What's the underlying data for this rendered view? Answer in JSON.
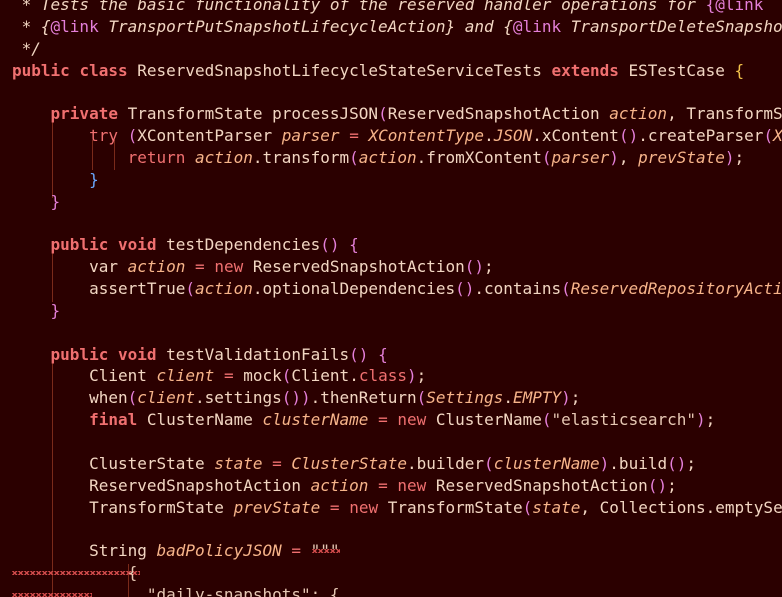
{
  "editor": {
    "lines": [
      [
        [
          "cmt",
          " * Tests the basic functionality of the reserved handler operations for "
        ],
        [
          "cmt-link",
          "{@link "
        ]
      ],
      [
        [
          "cmt",
          " * {"
        ],
        [
          "cmt-link",
          "@link"
        ],
        [
          "cmt",
          " TransportPutSnapshotLifecycleAction} and {"
        ],
        [
          "cmt-link",
          "@link"
        ],
        [
          "cmt",
          " TransportDeleteSnapshot"
        ]
      ],
      [
        [
          "cmt",
          " */"
        ]
      ],
      [
        [
          "kw",
          "public"
        ],
        [
          "punc",
          " "
        ],
        [
          "kw",
          "class"
        ],
        [
          "punc",
          " ReservedSnapshotLifecycleStateServiceTests "
        ],
        [
          "kw",
          "extends"
        ],
        [
          "punc",
          " ESTestCase "
        ],
        [
          "brace-y",
          "{"
        ]
      ],
      [],
      [
        [
          "punc",
          "    "
        ],
        [
          "kw",
          "private"
        ],
        [
          "punc",
          " TransformState processJSON"
        ],
        [
          "paren",
          "("
        ],
        [
          "punc",
          "ReservedSnapshotAction "
        ],
        [
          "var",
          "action"
        ],
        [
          "punc",
          ", TransformS"
        ]
      ],
      [
        [
          "punc",
          "        "
        ],
        [
          "kw2",
          "try"
        ],
        [
          "punc",
          " "
        ],
        [
          "paren",
          "("
        ],
        [
          "punc",
          "XContentParser "
        ],
        [
          "var",
          "parser"
        ],
        [
          "punc",
          " "
        ],
        [
          "op",
          "="
        ],
        [
          "punc",
          " "
        ],
        [
          "const",
          "XContentType"
        ],
        [
          "punc",
          "."
        ],
        [
          "const",
          "JSON"
        ],
        [
          "punc",
          ".xContent"
        ],
        [
          "paren",
          "()"
        ],
        [
          "punc",
          ".createParser"
        ],
        [
          "paren",
          "("
        ],
        [
          "var",
          "X"
        ]
      ],
      [
        [
          "punc",
          "            "
        ],
        [
          "kw2",
          "return"
        ],
        [
          "punc",
          " "
        ],
        [
          "var",
          "action"
        ],
        [
          "punc",
          ".transform"
        ],
        [
          "paren",
          "("
        ],
        [
          "var",
          "action"
        ],
        [
          "punc",
          ".fromXContent"
        ],
        [
          "paren",
          "("
        ],
        [
          "var",
          "parser"
        ],
        [
          "paren",
          ")"
        ],
        [
          "punc",
          ", "
        ],
        [
          "var",
          "prevState"
        ],
        [
          "paren",
          ")"
        ],
        [
          "punc",
          ";"
        ]
      ],
      [
        [
          "punc",
          "        "
        ],
        [
          "brace-b",
          "}"
        ]
      ],
      [
        [
          "punc",
          "    "
        ],
        [
          "brace-o",
          "}"
        ]
      ],
      [],
      [
        [
          "punc",
          "    "
        ],
        [
          "kw",
          "public"
        ],
        [
          "punc",
          " "
        ],
        [
          "kw",
          "void"
        ],
        [
          "punc",
          " testDependencies"
        ],
        [
          "paren",
          "()"
        ],
        [
          "punc",
          " "
        ],
        [
          "brace-o",
          "{"
        ]
      ],
      [
        [
          "punc",
          "        var "
        ],
        [
          "var",
          "action"
        ],
        [
          "punc",
          " "
        ],
        [
          "op",
          "="
        ],
        [
          "punc",
          " "
        ],
        [
          "kw2",
          "new"
        ],
        [
          "punc",
          " ReservedSnapshotAction"
        ],
        [
          "paren",
          "()"
        ],
        [
          "punc",
          ";"
        ]
      ],
      [
        [
          "punc",
          "        assertTrue"
        ],
        [
          "paren",
          "("
        ],
        [
          "var",
          "action"
        ],
        [
          "punc",
          ".optionalDependencies"
        ],
        [
          "paren",
          "()"
        ],
        [
          "punc",
          ".contains"
        ],
        [
          "paren",
          "("
        ],
        [
          "const",
          "ReservedRepositoryActi"
        ]
      ],
      [
        [
          "punc",
          "    "
        ],
        [
          "brace-o",
          "}"
        ]
      ],
      [],
      [
        [
          "punc",
          "    "
        ],
        [
          "kw",
          "public"
        ],
        [
          "punc",
          " "
        ],
        [
          "kw",
          "void"
        ],
        [
          "punc",
          " testValidationFails"
        ],
        [
          "paren",
          "()"
        ],
        [
          "punc",
          " "
        ],
        [
          "brace-o",
          "{"
        ]
      ],
      [
        [
          "punc",
          "        Client "
        ],
        [
          "var",
          "client"
        ],
        [
          "punc",
          " "
        ],
        [
          "op",
          "="
        ],
        [
          "punc",
          " mock"
        ],
        [
          "paren",
          "("
        ],
        [
          "punc",
          "Client."
        ],
        [
          "cls",
          "class"
        ],
        [
          "paren",
          ")"
        ],
        [
          "punc",
          ";"
        ]
      ],
      [
        [
          "punc",
          "        when"
        ],
        [
          "paren",
          "("
        ],
        [
          "var",
          "client"
        ],
        [
          "punc",
          ".settings"
        ],
        [
          "paren",
          "())"
        ],
        [
          "punc",
          ".thenReturn"
        ],
        [
          "paren",
          "("
        ],
        [
          "const",
          "Settings"
        ],
        [
          "punc",
          "."
        ],
        [
          "const",
          "EMPTY"
        ],
        [
          "paren",
          ")"
        ],
        [
          "punc",
          ";"
        ]
      ],
      [
        [
          "punc",
          "        "
        ],
        [
          "kw",
          "final"
        ],
        [
          "punc",
          " ClusterName "
        ],
        [
          "var",
          "clusterName"
        ],
        [
          "punc",
          " "
        ],
        [
          "op",
          "="
        ],
        [
          "punc",
          " "
        ],
        [
          "kw2",
          "new"
        ],
        [
          "punc",
          " ClusterName"
        ],
        [
          "paren",
          "("
        ],
        [
          "str",
          "\"elasticsearch\""
        ],
        [
          "paren",
          ")"
        ],
        [
          "punc",
          ";"
        ]
      ],
      [],
      [
        [
          "punc",
          "        ClusterState "
        ],
        [
          "var",
          "state"
        ],
        [
          "punc",
          " "
        ],
        [
          "op",
          "="
        ],
        [
          "punc",
          " "
        ],
        [
          "const",
          "ClusterState"
        ],
        [
          "punc",
          ".builder"
        ],
        [
          "paren",
          "("
        ],
        [
          "var",
          "clusterName"
        ],
        [
          "paren",
          ")"
        ],
        [
          "punc",
          ".build"
        ],
        [
          "paren",
          "()"
        ],
        [
          "punc",
          ";"
        ]
      ],
      [
        [
          "punc",
          "        ReservedSnapshotAction "
        ],
        [
          "var",
          "action"
        ],
        [
          "punc",
          " "
        ],
        [
          "op",
          "="
        ],
        [
          "punc",
          " "
        ],
        [
          "kw2",
          "new"
        ],
        [
          "punc",
          " ReservedSnapshotAction"
        ],
        [
          "paren",
          "()"
        ],
        [
          "punc",
          ";"
        ]
      ],
      [
        [
          "punc",
          "        TransformState "
        ],
        [
          "var",
          "prevState"
        ],
        [
          "punc",
          " "
        ],
        [
          "op",
          "="
        ],
        [
          "punc",
          " "
        ],
        [
          "kw2",
          "new"
        ],
        [
          "punc",
          " TransformState"
        ],
        [
          "paren",
          "("
        ],
        [
          "var",
          "state"
        ],
        [
          "punc",
          ", Collections.emptySe"
        ]
      ],
      [],
      [
        [
          "punc",
          "        String "
        ],
        [
          "var",
          "badPolicyJSON"
        ],
        [
          "punc",
          " "
        ],
        [
          "op",
          "="
        ],
        [
          "punc",
          " "
        ],
        [
          "str",
          "\"\"\""
        ]
      ],
      [
        [
          "str",
          "            {"
        ]
      ],
      [
        [
          "str",
          "              \"daily-snapshots\": {"
        ]
      ]
    ]
  }
}
